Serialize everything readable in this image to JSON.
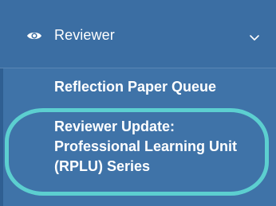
{
  "sidebar": {
    "section": {
      "icon": "eye-icon",
      "label": "Reviewer",
      "expand_icon": "chevron-down-icon"
    },
    "items": [
      {
        "label": "Reflection Paper Queue"
      },
      {
        "label_lines": [
          "Reviewer Update:",
          "Professional Learning Unit",
          "(RPLU) Series"
        ]
      }
    ]
  },
  "colors": {
    "sidebar_bg": "#3f73a8",
    "highlight_ring": "#5ccfd0",
    "text": "#ffffff"
  }
}
